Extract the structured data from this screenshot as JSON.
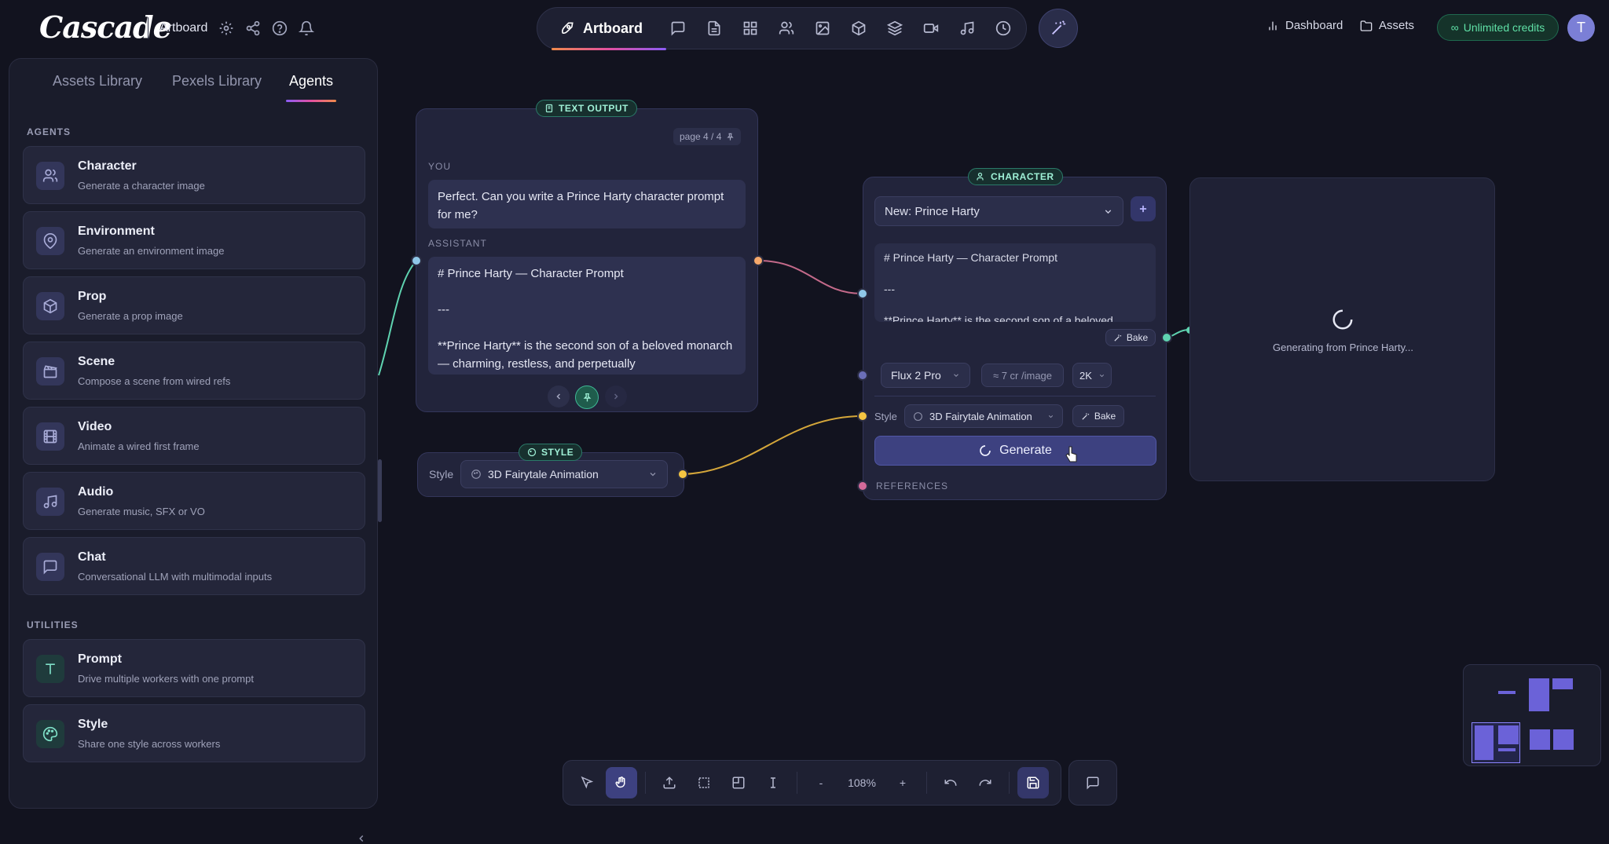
{
  "app": {
    "logo": "Cascade",
    "project_name": "Artboard"
  },
  "top_pill": {
    "active_label": "Artboard",
    "tools": [
      "chat-icon",
      "document-icon",
      "grid-icon",
      "users-icon",
      "image-icon",
      "cube-icon",
      "layers-icon",
      "video-icon",
      "music-icon",
      "history-icon"
    ]
  },
  "right_nav": {
    "dashboard": "Dashboard",
    "assets": "Assets",
    "credits": "Unlimited credits",
    "avatar": "T"
  },
  "colors": {
    "accent": "#8b5cf6",
    "port_blue": "#8fc7e8",
    "port_orange": "#f5a86b",
    "port_yellow": "#f5c542",
    "port_green": "#5fd3b0",
    "credits_green": "#5fe0a6"
  },
  "sidebar": {
    "tabs": [
      "Assets Library",
      "Pexels Library",
      "Agents"
    ],
    "active_tab": "Agents",
    "agents_heading": "AGENTS",
    "agents": [
      {
        "title": "Character",
        "subtitle": "Generate a character image",
        "icon": "users-icon"
      },
      {
        "title": "Environment",
        "subtitle": "Generate an environment image",
        "icon": "map-pin-icon"
      },
      {
        "title": "Prop",
        "subtitle": "Generate a prop image",
        "icon": "cube-icon"
      },
      {
        "title": "Scene",
        "subtitle": "Compose a scene from wired refs",
        "icon": "clapper-icon"
      },
      {
        "title": "Video",
        "subtitle": "Animate a wired first frame",
        "icon": "film-icon"
      },
      {
        "title": "Audio",
        "subtitle": "Generate music, SFX or VO",
        "icon": "music-icon"
      },
      {
        "title": "Chat",
        "subtitle": "Conversational LLM with multimodal inputs",
        "icon": "chat-icon"
      }
    ],
    "utilities_heading": "UTILITIES",
    "utilities": [
      {
        "title": "Prompt",
        "subtitle": "Drive multiple workers with one prompt",
        "icon": "text-icon"
      },
      {
        "title": "Style",
        "subtitle": "Share one style across workers",
        "icon": "palette-icon"
      }
    ]
  },
  "text_output": {
    "badge": "TEXT OUTPUT",
    "page": "page 4 / 4",
    "you_label": "YOU",
    "you_msg": "Perfect. Can you write a Prince Harty character prompt for me?",
    "assistant_label": "ASSISTANT",
    "assistant_line1": "# Prince Harty — Character Prompt",
    "assistant_line2": "---",
    "assistant_line3": "**Prince Harty** is the second son of a beloved monarch — charming, restless, and perpetually"
  },
  "style_node": {
    "badge": "STYLE",
    "label": "Style",
    "value": "3D Fairytale Animation"
  },
  "character_node": {
    "badge": "CHARACTER",
    "selected": "New: Prince Harty",
    "prompt_line1": "# Prince Harty — Character Prompt",
    "prompt_line2": "---",
    "prompt_line3": "**Prince Harty** is the second son of a beloved",
    "bake_label": "Bake",
    "model": "Flux 2 Pro",
    "cost": "≈ 7 cr /image",
    "resolution": "2K",
    "style_label": "Style",
    "style_value": "3D Fairytale Animation",
    "generate_label": "Generate",
    "references_label": "REFERENCES"
  },
  "output_node": {
    "status": "Generating from Prince Harty..."
  },
  "bottom_toolbar": {
    "zoom": "108%",
    "minus": "-",
    "plus": "+"
  }
}
